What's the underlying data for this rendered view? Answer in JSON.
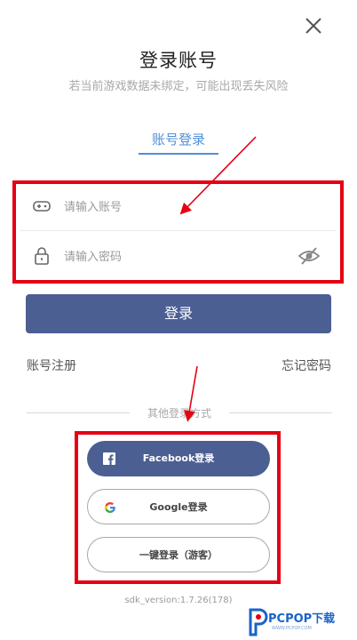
{
  "header": {
    "close_icon": "close-icon",
    "title": "登录账号",
    "subtitle": "若当前游戏数据未绑定，可能出现丢失风险"
  },
  "tabs": [
    {
      "label": "账号登录",
      "active": true
    }
  ],
  "form": {
    "account": {
      "placeholder": "请输入账号",
      "value": "",
      "icon": "gamepad-icon"
    },
    "password": {
      "placeholder": "请输入密码",
      "value": "",
      "icon": "lock-icon",
      "toggle_icon": "eye-hidden-icon"
    }
  },
  "login_button": "登录",
  "links": {
    "register": "账号注册",
    "forgot": "忘记密码"
  },
  "other_methods": {
    "label": "其他登录方式",
    "facebook": "Facebook登录",
    "google": "Google登录",
    "guest": "一键登录（游客）"
  },
  "footer": {
    "version": "sdk_version:1.7.26(178)"
  },
  "watermark": {
    "logo_text": "PCPOP下载",
    "sub_text": "WWW.PCPOP.COM"
  },
  "colors": {
    "accent": "#4f8fd6",
    "primary_button": "#4c5f93",
    "highlight_annotation": "#e50012"
  }
}
